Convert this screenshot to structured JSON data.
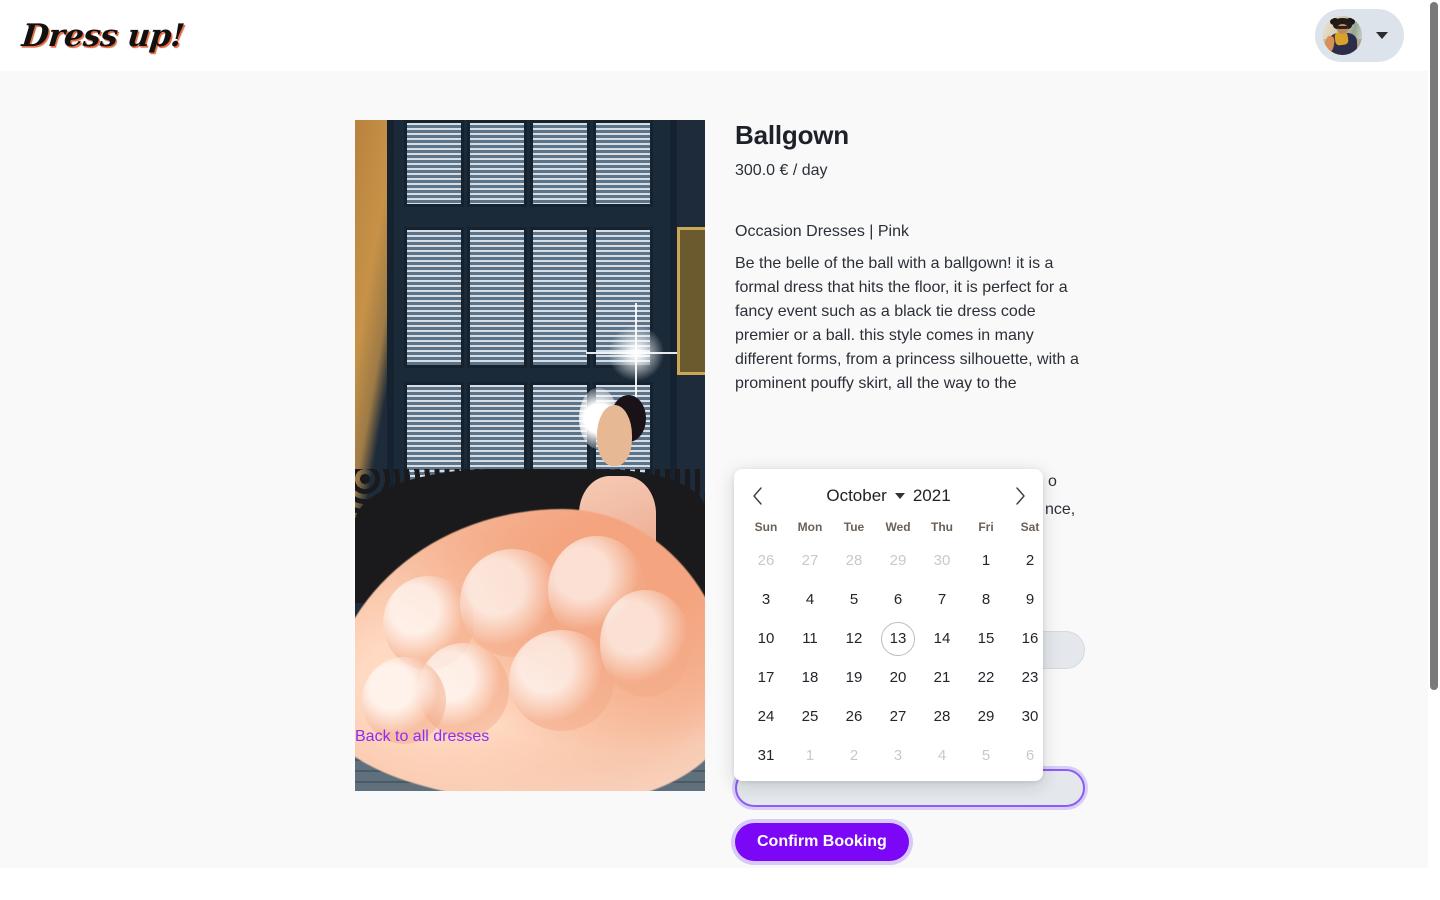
{
  "header": {
    "brand": "Dress up!",
    "avatar_alt": "user-avatar",
    "dropdown_icon": "chevron-down-icon"
  },
  "product": {
    "title": "Ballgown",
    "price": "300.0 € / day",
    "category": "Occasion Dresses | Pink",
    "description": "Be the belle of the ball with a ballgown! it is a formal dress that hits the floor, it is perfect for a fancy event such as a black tie dress code premier or a ball. this style comes in many different forms, from a princess silhouette, with a prominent pouffy skirt, all the way to the",
    "description_fragment_1": "o",
    "description_fragment_2": "nce,",
    "image_alt": "ballgown-product-photo",
    "back_link": "Back to all dresses"
  },
  "booking": {
    "start_date_value": "",
    "end_date_value": "",
    "confirm_label": "Confirm Booking"
  },
  "calendar": {
    "prev_icon": "chevron-left-icon",
    "next_icon": "chevron-right-icon",
    "month": "October",
    "year": "2021",
    "month_caret_icon": "chevron-down-icon",
    "weekdays": [
      "Sun",
      "Mon",
      "Tue",
      "Wed",
      "Thu",
      "Fri",
      "Sat"
    ],
    "today": "13",
    "weeks": [
      [
        {
          "n": "26",
          "muted": true
        },
        {
          "n": "27",
          "muted": true
        },
        {
          "n": "28",
          "muted": true
        },
        {
          "n": "29",
          "muted": true
        },
        {
          "n": "30",
          "muted": true
        },
        {
          "n": "1",
          "muted": false
        },
        {
          "n": "2",
          "muted": false
        }
      ],
      [
        {
          "n": "3",
          "muted": false
        },
        {
          "n": "4",
          "muted": false
        },
        {
          "n": "5",
          "muted": false
        },
        {
          "n": "6",
          "muted": false
        },
        {
          "n": "7",
          "muted": false
        },
        {
          "n": "8",
          "muted": false
        },
        {
          "n": "9",
          "muted": false
        }
      ],
      [
        {
          "n": "10",
          "muted": false
        },
        {
          "n": "11",
          "muted": false
        },
        {
          "n": "12",
          "muted": false
        },
        {
          "n": "13",
          "muted": false
        },
        {
          "n": "14",
          "muted": false
        },
        {
          "n": "15",
          "muted": false
        },
        {
          "n": "16",
          "muted": false
        }
      ],
      [
        {
          "n": "17",
          "muted": false
        },
        {
          "n": "18",
          "muted": false
        },
        {
          "n": "19",
          "muted": false
        },
        {
          "n": "20",
          "muted": false
        },
        {
          "n": "21",
          "muted": false
        },
        {
          "n": "22",
          "muted": false
        },
        {
          "n": "23",
          "muted": false
        }
      ],
      [
        {
          "n": "24",
          "muted": false
        },
        {
          "n": "25",
          "muted": false
        },
        {
          "n": "26",
          "muted": false
        },
        {
          "n": "27",
          "muted": false
        },
        {
          "n": "28",
          "muted": false
        },
        {
          "n": "29",
          "muted": false
        },
        {
          "n": "30",
          "muted": false
        }
      ],
      [
        {
          "n": "31",
          "muted": false
        },
        {
          "n": "1",
          "muted": true
        },
        {
          "n": "2",
          "muted": true
        },
        {
          "n": "3",
          "muted": true
        },
        {
          "n": "4",
          "muted": true
        },
        {
          "n": "5",
          "muted": true
        },
        {
          "n": "6",
          "muted": true
        }
      ]
    ]
  },
  "colors": {
    "accent_purple": "#7c07f7",
    "link_purple": "#8b2ef5",
    "page_bg": "#f9f9f9",
    "header_bg": "#ffffff",
    "pill_bg": "#dde3ea",
    "input_bg": "#e4e8ec"
  }
}
